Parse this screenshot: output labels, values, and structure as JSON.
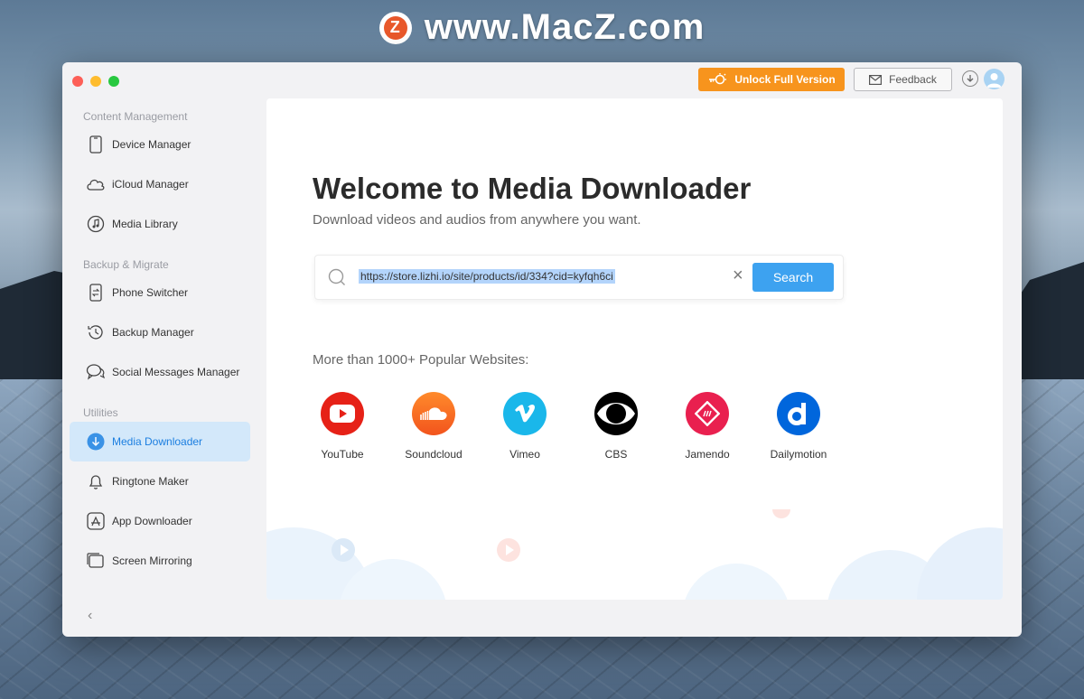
{
  "watermark": {
    "logo_letter": "Z",
    "text": "www.MacZ.com"
  },
  "topbar": {
    "unlock_label": "Unlock Full Version",
    "feedback_label": "Feedback"
  },
  "sidebar": {
    "sections": [
      {
        "title": "Content Management"
      },
      {
        "title": "Backup & Migrate"
      },
      {
        "title": "Utilities"
      }
    ],
    "items": [
      {
        "label": "Device Manager",
        "icon": "phone-icon"
      },
      {
        "label": "iCloud Manager",
        "icon": "cloud-icon"
      },
      {
        "label": "Media Library",
        "icon": "music-icon"
      },
      {
        "label": "Phone Switcher",
        "icon": "phone-switch-icon"
      },
      {
        "label": "Backup Manager",
        "icon": "history-icon"
      },
      {
        "label": "Social Messages Manager",
        "icon": "chat-icon"
      },
      {
        "label": "Media Downloader",
        "icon": "download-icon",
        "active": true
      },
      {
        "label": "Ringtone Maker",
        "icon": "bell-icon"
      },
      {
        "label": "App Downloader",
        "icon": "app-store-icon"
      },
      {
        "label": "Screen Mirroring",
        "icon": "screen-icon"
      }
    ]
  },
  "main": {
    "title": "Welcome to Media Downloader",
    "subtitle": "Download videos and audios from anywhere you want.",
    "search": {
      "value": "https://store.lizhi.io/site/products/id/334?cid=kyfqh6ci",
      "button_label": "Search"
    },
    "popular_label": "More than 1000+ Popular Websites:",
    "sites": [
      {
        "name": "YouTube",
        "color": "#e62117"
      },
      {
        "name": "Soundcloud",
        "color": "#f26f23"
      },
      {
        "name": "Vimeo",
        "color": "#1ab7ea"
      },
      {
        "name": "CBS",
        "color": "#000000"
      },
      {
        "name": "Jamendo",
        "color": "#e9204f"
      },
      {
        "name": "Dailymotion",
        "color": "#0066dc"
      }
    ]
  },
  "colors": {
    "accent": "#3da2f0",
    "unlock": "#f7941d",
    "active_bg": "#d3e8fa"
  }
}
